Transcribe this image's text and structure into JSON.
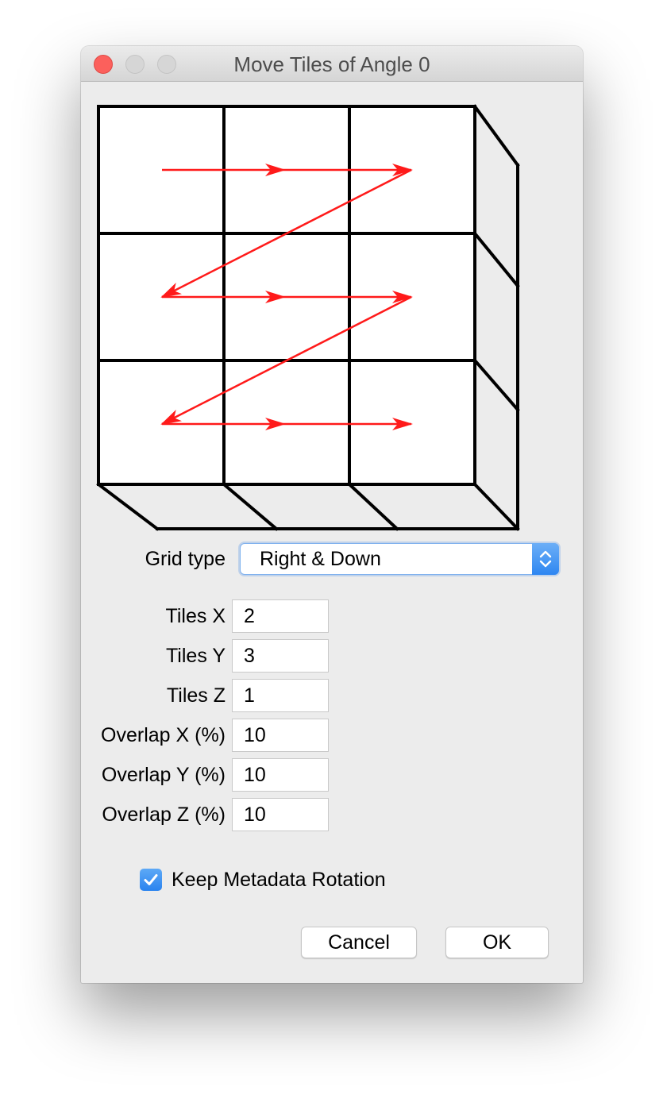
{
  "window": {
    "title": "Move Tiles of Angle 0"
  },
  "diagram": {
    "grid_columns": 3,
    "grid_rows": 3,
    "arrow_color": "#ff1a1a",
    "arrow_path": "right-then-down-zigzag"
  },
  "grid_type": {
    "label": "Grid type",
    "selected": "Right & Down"
  },
  "fields": [
    {
      "label": "Tiles X",
      "value": "2"
    },
    {
      "label": "Tiles Y",
      "value": "3"
    },
    {
      "label": "Tiles Z",
      "value": "1"
    },
    {
      "label": "Overlap X (%)",
      "value": "10"
    },
    {
      "label": "Overlap Y (%)",
      "value": "10"
    },
    {
      "label": "Overlap Z (%)",
      "value": "10"
    }
  ],
  "keep_metadata": {
    "label": "Keep Metadata Rotation",
    "checked": true
  },
  "buttons": {
    "cancel": "Cancel",
    "ok": "OK"
  },
  "icons": {
    "close": "close-icon",
    "minimize": "minimize-icon",
    "zoom": "zoom-icon",
    "stepper": "up-down-chevron-icon",
    "checkmark": "checkmark-icon"
  },
  "colors": {
    "accent": "#2e86f1",
    "close_button": "#fc605c",
    "window_bg": "#ececec"
  }
}
